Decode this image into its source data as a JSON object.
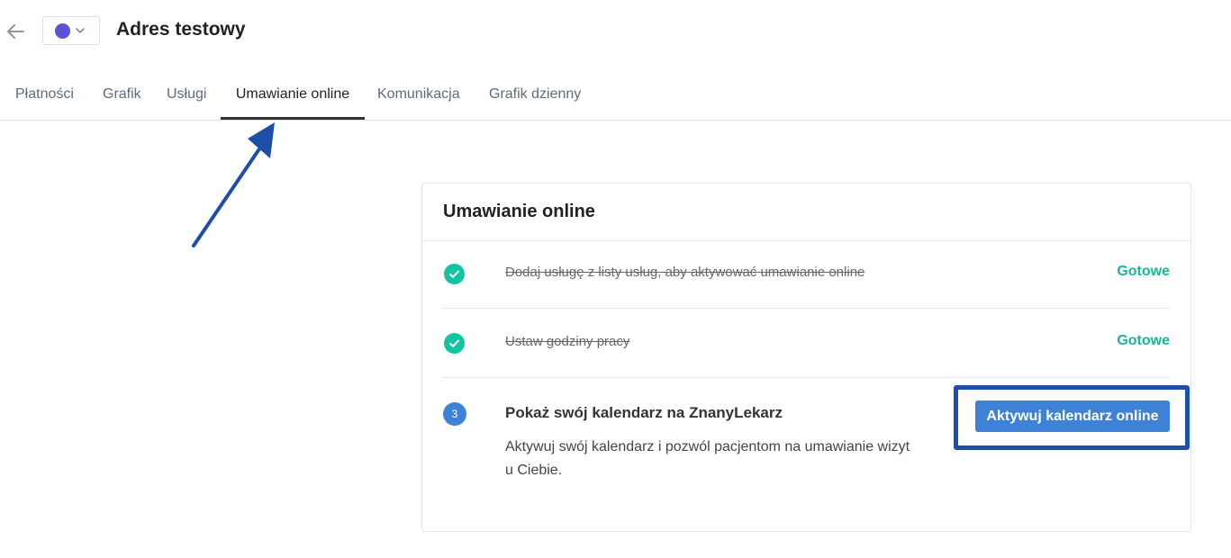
{
  "header": {
    "title": "Adres testowy",
    "color": "#5b52d6",
    "back_icon": "arrow-left-icon"
  },
  "tabs": [
    {
      "label": "Płatności",
      "active": false
    },
    {
      "label": "Grafik",
      "active": false
    },
    {
      "label": "Usługi",
      "active": false
    },
    {
      "label": "Umawianie online",
      "active": true
    },
    {
      "label": "Komunikacja",
      "active": false
    },
    {
      "label": "Grafik dzienny",
      "active": false
    }
  ],
  "card": {
    "title": "Umawianie online",
    "steps": [
      {
        "text": "Dodaj usługę z listy usług, aby aktywować umawianie online",
        "status": "Gotowe",
        "done": true
      },
      {
        "text": "Ustaw godziny pracy",
        "status": "Gotowe",
        "done": true
      },
      {
        "number": "3",
        "title": "Pokaż swój kalendarz na ZnanyLekarz",
        "description": "Aktywuj swój kalendarz i pozwól pacjentom na umawianie wizyt u Ciebie.",
        "done": false
      }
    ],
    "button_label": "Aktywuj kalendarz online"
  },
  "colors": {
    "accent": "#3d82d6",
    "success": "#13c4a3",
    "annotation": "#1d4fa8"
  }
}
